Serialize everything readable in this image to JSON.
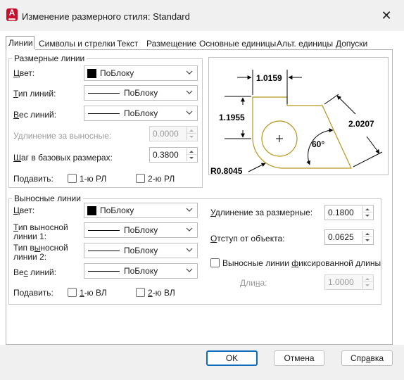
{
  "window": {
    "title": "Изменение размерного стиля: Standard",
    "app_icon_letter": "A"
  },
  "tabs": [
    {
      "label": "Линии",
      "active": true
    },
    {
      "label": "Символы и стрелки"
    },
    {
      "label": "Текст"
    },
    {
      "label": "Размещение"
    },
    {
      "label": "Основные единицы"
    },
    {
      "label": "Альт. единицы"
    },
    {
      "label": "Допуски"
    }
  ],
  "dim_lines": {
    "title": "Размерные линии",
    "color_label": "Цвет:",
    "color_value": "ПоБлоку",
    "linetype_label": "Тип линий:",
    "linetype_value": "ПоБлоку",
    "lineweight_label": "Вес линий:",
    "lineweight_value": "ПоБлоку",
    "extension_label": "Удлинение за выносные:",
    "extension_value": "0.0000",
    "baseline_label": "Шаг в базовых размерах:",
    "baseline_value": "0.3800",
    "suppress_label": "Подавить:",
    "suppress_1": "1-ю РЛ",
    "suppress_2": "2-ю РЛ"
  },
  "ext_lines": {
    "title": "Выносные линии",
    "color_label": "Цвет:",
    "color_value": "ПоБлоку",
    "linetype1_label_a": "Тип выносной",
    "linetype1_label_b": "линии 1:",
    "linetype1_value": "ПоБлоку",
    "linetype2_label_a": "Тип выносной",
    "linetype2_label_b": "линии 2:",
    "linetype2_value": "ПоБлоку",
    "lineweight_label": "Вес линий:",
    "lineweight_value": "ПоБлоку",
    "suppress_label": "Подавить:",
    "suppress_1": "1-ю ВЛ",
    "suppress_2": "2-ю ВЛ",
    "beyond_label": "Удлинение за размерные:",
    "beyond_value": "0.1800",
    "offset_label": "Отступ от объекта:",
    "offset_value": "0.0625",
    "fixed_label": "Выносные линии фиксированной длины",
    "length_label": "Длина:",
    "length_value": "1.0000"
  },
  "preview": {
    "dim_top": "1.0159",
    "dim_left": "1.1955",
    "dim_right": "2.0207",
    "angle": "60°",
    "radius": "R0.8045"
  },
  "buttons": {
    "ok": "OK",
    "cancel": "Отмена",
    "help": "Справка"
  },
  "colors": {
    "accent": "#0f6cbd",
    "outline": "#b8961e",
    "app_icon": "#c8102e"
  }
}
